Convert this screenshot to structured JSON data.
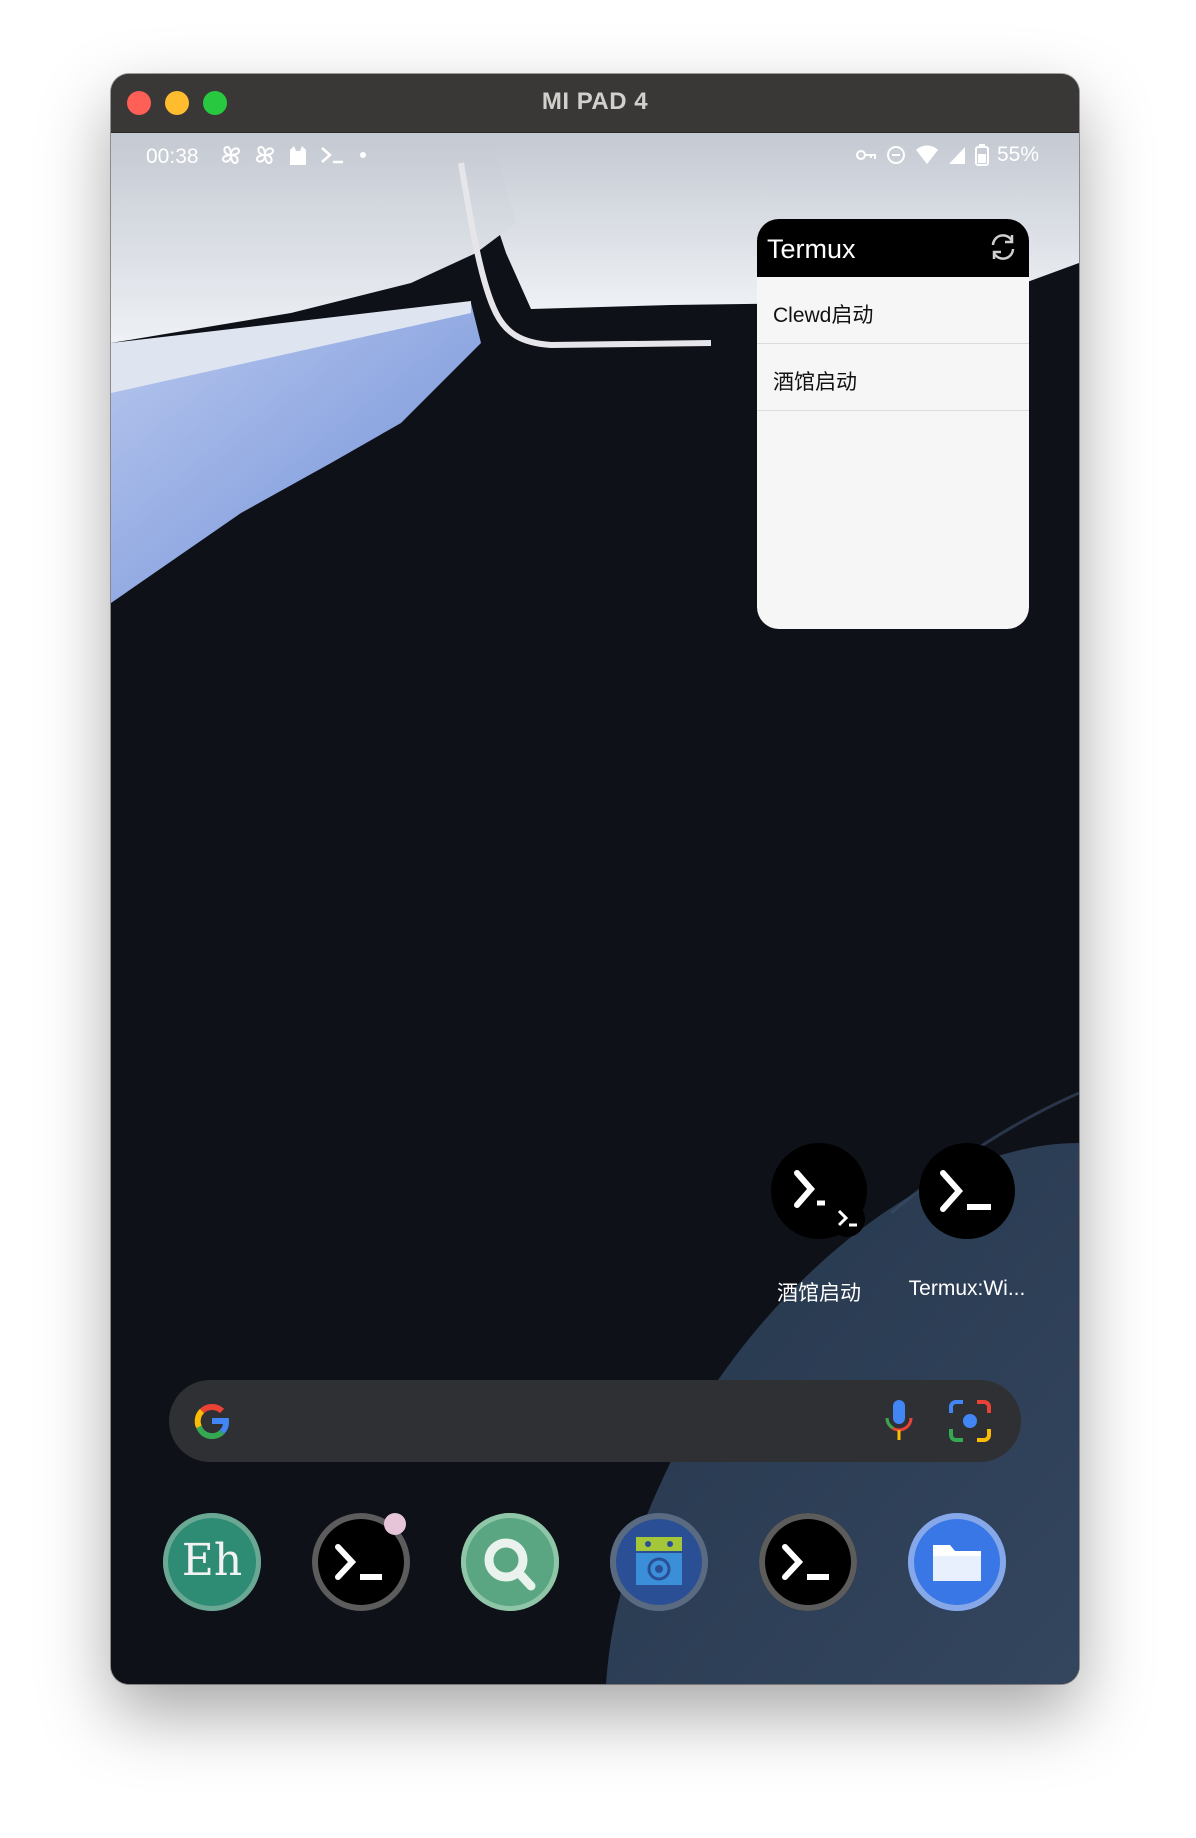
{
  "window": {
    "title": "MI PAD 4"
  },
  "status_bar": {
    "time": "00:38",
    "left_icons": [
      "pinwheel-icon",
      "pinwheel-icon",
      "cat-icon",
      "terminal-icon",
      "dot-icon"
    ],
    "right_icons": [
      "vpn-key-icon",
      "do-not-disturb-icon",
      "wifi-icon",
      "signal-icon",
      "battery-icon"
    ],
    "battery_percent": "55%"
  },
  "widget": {
    "title": "Termux",
    "items": [
      {
        "label": "Clewd启动"
      },
      {
        "label": "酒馆启动"
      }
    ]
  },
  "home_shortcuts": [
    {
      "label": "酒馆启动",
      "icon": "terminal-shortcut-icon"
    },
    {
      "label": "Termux:Wi...",
      "icon": "terminal-icon"
    }
  ],
  "search_bar": {
    "icons": [
      "google-logo-icon",
      "microphone-icon",
      "google-lens-icon"
    ]
  },
  "dock": [
    {
      "name": "eh-app",
      "label": "Eh",
      "color": "#2e8c74"
    },
    {
      "name": "termux-app",
      "icon": "terminal-icon"
    },
    {
      "name": "search-app",
      "icon": "magnifier-icon",
      "color": "#5aa582"
    },
    {
      "name": "android-app",
      "icon": "android-icon",
      "color": "#2a4f95"
    },
    {
      "name": "termux-alt-app",
      "icon": "terminal-icon"
    },
    {
      "name": "files-app",
      "icon": "folder-icon",
      "color": "#3a77e6"
    }
  ],
  "colors": {
    "titlebar": "#3a3836",
    "wallpaper_dark": "#0f1119",
    "widget_header": "#000000",
    "search_bar": "#2f3033"
  }
}
